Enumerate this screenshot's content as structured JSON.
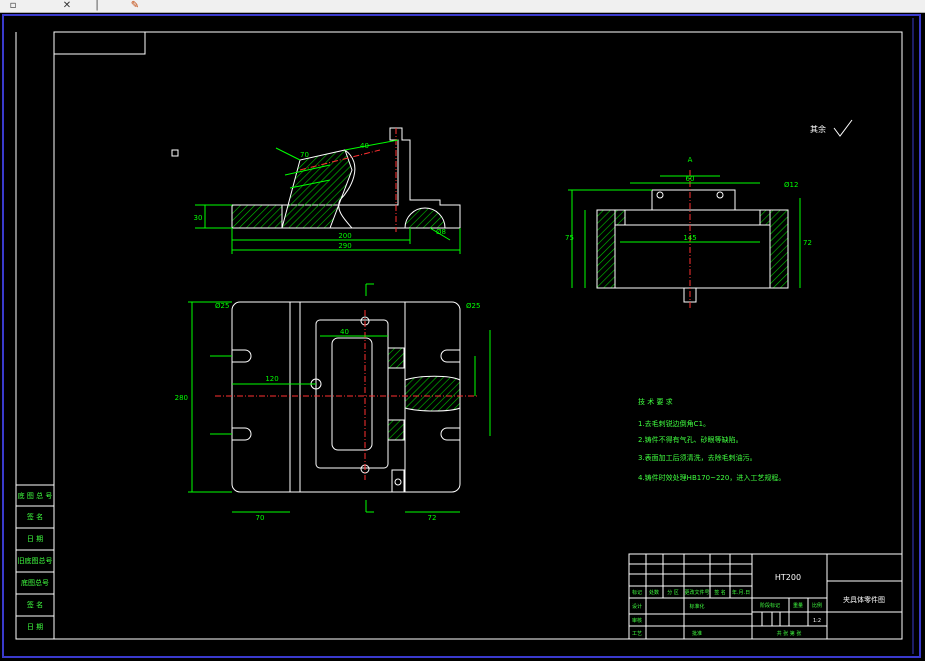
{
  "toolbar": {
    "buttons": [
      {
        "name": "toolbar-tool-1-icon"
      },
      {
        "name": "toolbar-cross-icon"
      },
      {
        "name": "toolbar-line-icon"
      },
      {
        "name": "toolbar-paint-icon"
      }
    ]
  },
  "colors": {
    "border": "#3a3acc",
    "frame": "#ffffff",
    "dim": "#00ff00",
    "hatch": "#00c800",
    "center": "#ff3030",
    "text": "#ffffff",
    "notes": "#40ff40"
  },
  "drawing": {
    "surface_symbol": "其余",
    "notes": [
      "技 术 要 求",
      "1.去毛刺锐边倒角C1。",
      "2.铸件不得有气孔、砂眼等缺陷。",
      "3.表面加工后须清洗，去除毛刺油污。",
      "4.铸件时效处理HB170~220，进入工艺规程。"
    ],
    "dims": {
      "d1": "30",
      "d2": "Ø8",
      "d3": "200",
      "d4": "290",
      "d5": "40",
      "d6": "60",
      "d7": "Ø12",
      "d8": "145",
      "d9": "280",
      "d10": "70",
      "d11": "72",
      "d12": "75",
      "d13": "Ø25",
      "d14": "120"
    },
    "section_label": "A",
    "left_labels": [
      "底 图 总 号",
      "签 名",
      "日 期",
      "旧底图总号",
      "底图总号",
      "签 名",
      "日 期"
    ],
    "title_block": {
      "material": "HT200",
      "drawing_name": "夹具体零件图",
      "row_labels": [
        "标记",
        "处数",
        "分 区",
        "更改文件号",
        "签 名",
        "年.月.日"
      ],
      "design": "设计",
      "check": "审核",
      "process": "工艺",
      "approve": "批准",
      "standard": "标准化",
      "stage": "阶段标记",
      "weight": "重量",
      "scale": "比例",
      "scale_val": "1:2",
      "sheet": "共  张  第  张"
    }
  }
}
